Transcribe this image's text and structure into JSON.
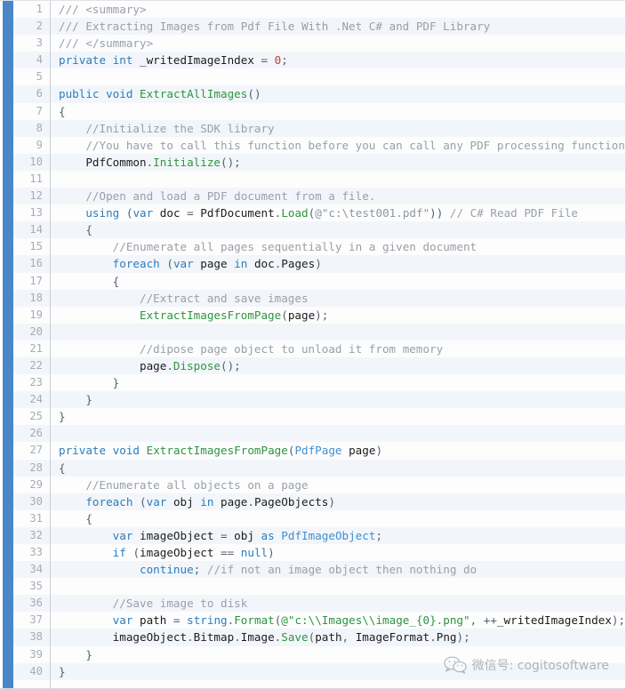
{
  "editor": {
    "language": "C#",
    "line_count": 40,
    "accent_color": "#4a86c8",
    "background_odd": "#fdfdfe",
    "background_even": "#f2f6fa",
    "gutter_color": "#a8acb3",
    "colors": {
      "keyword": "#2b7dbc",
      "comment": "#9aa0a6",
      "function": "#2e9440",
      "string": "#2e9440",
      "type": "#3f8fd0",
      "number": "#b5403a",
      "plain": "#1c1c1c"
    }
  },
  "watermark": {
    "icon": "wechat-icon",
    "text": "微信号: cogitosoftware"
  },
  "lines": [
    {
      "n": 1,
      "tokens": [
        {
          "t": "cmt",
          "v": "/// <summary>"
        }
      ]
    },
    {
      "n": 2,
      "tokens": [
        {
          "t": "cmt",
          "v": "/// Extracting Images from Pdf File With .Net C# and PDF Library"
        }
      ]
    },
    {
      "n": 3,
      "tokens": [
        {
          "t": "cmt",
          "v": "/// </summary>"
        }
      ]
    },
    {
      "n": 4,
      "tokens": [
        {
          "t": "kw",
          "v": "private"
        },
        {
          "t": "plain",
          "v": " "
        },
        {
          "t": "kw",
          "v": "int"
        },
        {
          "t": "plain",
          "v": " _writedImageIndex "
        },
        {
          "t": "punc",
          "v": "="
        },
        {
          "t": "plain",
          "v": " "
        },
        {
          "t": "num",
          "v": "0"
        },
        {
          "t": "punc",
          "v": ";"
        }
      ]
    },
    {
      "n": 5,
      "tokens": []
    },
    {
      "n": 6,
      "tokens": [
        {
          "t": "kw",
          "v": "public"
        },
        {
          "t": "plain",
          "v": " "
        },
        {
          "t": "kw",
          "v": "void"
        },
        {
          "t": "plain",
          "v": " "
        },
        {
          "t": "fn",
          "v": "ExtractAllImages"
        },
        {
          "t": "punc",
          "v": "()"
        }
      ]
    },
    {
      "n": 7,
      "tokens": [
        {
          "t": "punc",
          "v": "{"
        }
      ]
    },
    {
      "n": 8,
      "tokens": [
        {
          "t": "plain",
          "v": "    "
        },
        {
          "t": "cmt",
          "v": "//Initialize the SDK library"
        }
      ]
    },
    {
      "n": 9,
      "tokens": [
        {
          "t": "plain",
          "v": "    "
        },
        {
          "t": "cmt",
          "v": "//You have to call this function before you can call any PDF processing functions."
        }
      ]
    },
    {
      "n": 10,
      "tokens": [
        {
          "t": "plain",
          "v": "    PdfCommon"
        },
        {
          "t": "punc",
          "v": "."
        },
        {
          "t": "fn",
          "v": "Initialize"
        },
        {
          "t": "punc",
          "v": "();"
        }
      ]
    },
    {
      "n": 11,
      "tokens": []
    },
    {
      "n": 12,
      "tokens": [
        {
          "t": "plain",
          "v": "    "
        },
        {
          "t": "cmt",
          "v": "//Open and load a PDF document from a file."
        }
      ]
    },
    {
      "n": 13,
      "tokens": [
        {
          "t": "plain",
          "v": "    "
        },
        {
          "t": "kw",
          "v": "using"
        },
        {
          "t": "plain",
          "v": " "
        },
        {
          "t": "punc",
          "v": "("
        },
        {
          "t": "kw",
          "v": "var"
        },
        {
          "t": "plain",
          "v": " doc "
        },
        {
          "t": "punc",
          "v": "="
        },
        {
          "t": "plain",
          "v": " PdfDocument"
        },
        {
          "t": "punc",
          "v": "."
        },
        {
          "t": "fn",
          "v": "Load"
        },
        {
          "t": "punc",
          "v": "("
        },
        {
          "t": "str-d",
          "v": "@\"c:\\test001.pdf\""
        },
        {
          "t": "punc",
          "v": "))"
        },
        {
          "t": "plain",
          "v": " "
        },
        {
          "t": "cmt",
          "v": "// C# Read PDF File"
        }
      ]
    },
    {
      "n": 14,
      "tokens": [
        {
          "t": "plain",
          "v": "    "
        },
        {
          "t": "punc",
          "v": "{"
        }
      ]
    },
    {
      "n": 15,
      "tokens": [
        {
          "t": "plain",
          "v": "        "
        },
        {
          "t": "cmt",
          "v": "//Enumerate all pages sequentially in a given document"
        }
      ]
    },
    {
      "n": 16,
      "tokens": [
        {
          "t": "plain",
          "v": "        "
        },
        {
          "t": "kw",
          "v": "foreach"
        },
        {
          "t": "plain",
          "v": " "
        },
        {
          "t": "punc",
          "v": "("
        },
        {
          "t": "kw",
          "v": "var"
        },
        {
          "t": "plain",
          "v": " page "
        },
        {
          "t": "kw",
          "v": "in"
        },
        {
          "t": "plain",
          "v": " doc"
        },
        {
          "t": "punc",
          "v": "."
        },
        {
          "t": "plain",
          "v": "Pages"
        },
        {
          "t": "punc",
          "v": ")"
        }
      ]
    },
    {
      "n": 17,
      "tokens": [
        {
          "t": "plain",
          "v": "        "
        },
        {
          "t": "punc",
          "v": "{"
        }
      ]
    },
    {
      "n": 18,
      "tokens": [
        {
          "t": "plain",
          "v": "            "
        },
        {
          "t": "cmt",
          "v": "//Extract and save images"
        }
      ]
    },
    {
      "n": 19,
      "tokens": [
        {
          "t": "plain",
          "v": "            "
        },
        {
          "t": "fn",
          "v": "ExtractImagesFromPage"
        },
        {
          "t": "punc",
          "v": "("
        },
        {
          "t": "plain",
          "v": "page"
        },
        {
          "t": "punc",
          "v": ");"
        }
      ]
    },
    {
      "n": 20,
      "tokens": []
    },
    {
      "n": 21,
      "tokens": [
        {
          "t": "plain",
          "v": "            "
        },
        {
          "t": "cmt",
          "v": "//dipose page object to unload it from memory"
        }
      ]
    },
    {
      "n": 22,
      "tokens": [
        {
          "t": "plain",
          "v": "            page"
        },
        {
          "t": "punc",
          "v": "."
        },
        {
          "t": "fn",
          "v": "Dispose"
        },
        {
          "t": "punc",
          "v": "();"
        }
      ]
    },
    {
      "n": 23,
      "tokens": [
        {
          "t": "plain",
          "v": "        "
        },
        {
          "t": "punc",
          "v": "}"
        }
      ]
    },
    {
      "n": 24,
      "tokens": [
        {
          "t": "plain",
          "v": "    "
        },
        {
          "t": "punc",
          "v": "}"
        }
      ]
    },
    {
      "n": 25,
      "tokens": [
        {
          "t": "punc",
          "v": "}"
        }
      ]
    },
    {
      "n": 26,
      "tokens": []
    },
    {
      "n": 27,
      "tokens": [
        {
          "t": "kw",
          "v": "private"
        },
        {
          "t": "plain",
          "v": " "
        },
        {
          "t": "kw",
          "v": "void"
        },
        {
          "t": "plain",
          "v": " "
        },
        {
          "t": "fn",
          "v": "ExtractImagesFromPage"
        },
        {
          "t": "punc",
          "v": "("
        },
        {
          "t": "type",
          "v": "PdfPage"
        },
        {
          "t": "plain",
          "v": " page"
        },
        {
          "t": "punc",
          "v": ")"
        }
      ]
    },
    {
      "n": 28,
      "tokens": [
        {
          "t": "punc",
          "v": "{"
        }
      ]
    },
    {
      "n": 29,
      "tokens": [
        {
          "t": "plain",
          "v": "    "
        },
        {
          "t": "cmt",
          "v": "//Enumerate all objects on a page"
        }
      ]
    },
    {
      "n": 30,
      "tokens": [
        {
          "t": "plain",
          "v": "    "
        },
        {
          "t": "kw",
          "v": "foreach"
        },
        {
          "t": "plain",
          "v": " "
        },
        {
          "t": "punc",
          "v": "("
        },
        {
          "t": "kw",
          "v": "var"
        },
        {
          "t": "plain",
          "v": " obj "
        },
        {
          "t": "kw",
          "v": "in"
        },
        {
          "t": "plain",
          "v": " page"
        },
        {
          "t": "punc",
          "v": "."
        },
        {
          "t": "plain",
          "v": "PageObjects"
        },
        {
          "t": "punc",
          "v": ")"
        }
      ]
    },
    {
      "n": 31,
      "tokens": [
        {
          "t": "plain",
          "v": "    "
        },
        {
          "t": "punc",
          "v": "{"
        }
      ]
    },
    {
      "n": 32,
      "tokens": [
        {
          "t": "plain",
          "v": "        "
        },
        {
          "t": "kw",
          "v": "var"
        },
        {
          "t": "plain",
          "v": " imageObject "
        },
        {
          "t": "punc",
          "v": "="
        },
        {
          "t": "plain",
          "v": " obj "
        },
        {
          "t": "kw",
          "v": "as"
        },
        {
          "t": "plain",
          "v": " "
        },
        {
          "t": "type",
          "v": "PdfImageObject"
        },
        {
          "t": "punc",
          "v": ";"
        }
      ]
    },
    {
      "n": 33,
      "tokens": [
        {
          "t": "plain",
          "v": "        "
        },
        {
          "t": "kw",
          "v": "if"
        },
        {
          "t": "plain",
          "v": " "
        },
        {
          "t": "punc",
          "v": "("
        },
        {
          "t": "plain",
          "v": "imageObject "
        },
        {
          "t": "punc",
          "v": "=="
        },
        {
          "t": "plain",
          "v": " "
        },
        {
          "t": "kw",
          "v": "null"
        },
        {
          "t": "punc",
          "v": ")"
        }
      ]
    },
    {
      "n": 34,
      "tokens": [
        {
          "t": "plain",
          "v": "            "
        },
        {
          "t": "kw",
          "v": "continue"
        },
        {
          "t": "punc",
          "v": ";"
        },
        {
          "t": "plain",
          "v": " "
        },
        {
          "t": "cmt",
          "v": "//if not an image object then nothing do"
        }
      ]
    },
    {
      "n": 35,
      "tokens": []
    },
    {
      "n": 36,
      "tokens": [
        {
          "t": "plain",
          "v": "        "
        },
        {
          "t": "cmt",
          "v": "//Save image to disk"
        }
      ]
    },
    {
      "n": 37,
      "tokens": [
        {
          "t": "plain",
          "v": "        "
        },
        {
          "t": "kw",
          "v": "var"
        },
        {
          "t": "plain",
          "v": " path "
        },
        {
          "t": "punc",
          "v": "="
        },
        {
          "t": "plain",
          "v": " "
        },
        {
          "t": "kw",
          "v": "string"
        },
        {
          "t": "punc",
          "v": "."
        },
        {
          "t": "fn",
          "v": "Format"
        },
        {
          "t": "punc",
          "v": "("
        },
        {
          "t": "str",
          "v": "@\"c:\\\\Images\\\\image_{0}.png\""
        },
        {
          "t": "punc",
          "v": ","
        },
        {
          "t": "plain",
          "v": " "
        },
        {
          "t": "punc",
          "v": "++"
        },
        {
          "t": "plain",
          "v": "_writedImageIndex"
        },
        {
          "t": "punc",
          "v": ");"
        }
      ]
    },
    {
      "n": 38,
      "tokens": [
        {
          "t": "plain",
          "v": "        imageObject"
        },
        {
          "t": "punc",
          "v": "."
        },
        {
          "t": "plain",
          "v": "Bitmap"
        },
        {
          "t": "punc",
          "v": "."
        },
        {
          "t": "plain",
          "v": "Image"
        },
        {
          "t": "punc",
          "v": "."
        },
        {
          "t": "fn",
          "v": "Save"
        },
        {
          "t": "punc",
          "v": "("
        },
        {
          "t": "plain",
          "v": "path"
        },
        {
          "t": "punc",
          "v": ","
        },
        {
          "t": "plain",
          "v": " ImageFormat"
        },
        {
          "t": "punc",
          "v": "."
        },
        {
          "t": "plain",
          "v": "Png"
        },
        {
          "t": "punc",
          "v": ");"
        }
      ]
    },
    {
      "n": 39,
      "tokens": [
        {
          "t": "plain",
          "v": "    "
        },
        {
          "t": "punc",
          "v": "}"
        }
      ]
    },
    {
      "n": 40,
      "tokens": [
        {
          "t": "punc",
          "v": "}"
        }
      ]
    }
  ]
}
